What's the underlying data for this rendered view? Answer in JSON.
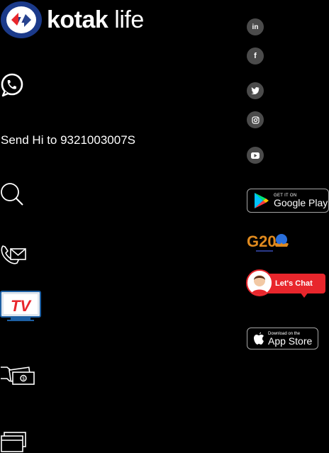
{
  "brand": {
    "name_bold": "kotak",
    "name_light": "life"
  },
  "whatsapp": {
    "send_text": "Send Hi to 9321003007S"
  },
  "left_icons": [
    "whatsapp-icon",
    "search-icon",
    "call-mail-icon",
    "tv-icon",
    "money-transfer-icon",
    "cards-icon"
  ],
  "tv_label": "TV",
  "social": [
    {
      "name": "linkedin",
      "label": "in"
    },
    {
      "name": "facebook",
      "label": "f"
    },
    {
      "name": "twitter",
      "label": ""
    },
    {
      "name": "instagram",
      "label": ""
    },
    {
      "name": "youtube",
      "label": ""
    }
  ],
  "google_play": {
    "small": "GET IT ON",
    "big": "Google Play"
  },
  "g20": {
    "label": "G20"
  },
  "chat": {
    "label": "Let's Chat"
  },
  "app_store": {
    "small": "Download on the",
    "big": "App Store"
  },
  "colors": {
    "background": "#000000",
    "brand_red": "#e8262c",
    "brand_blue": "#1b3a8a",
    "social_grey": "#4b4b4b"
  }
}
